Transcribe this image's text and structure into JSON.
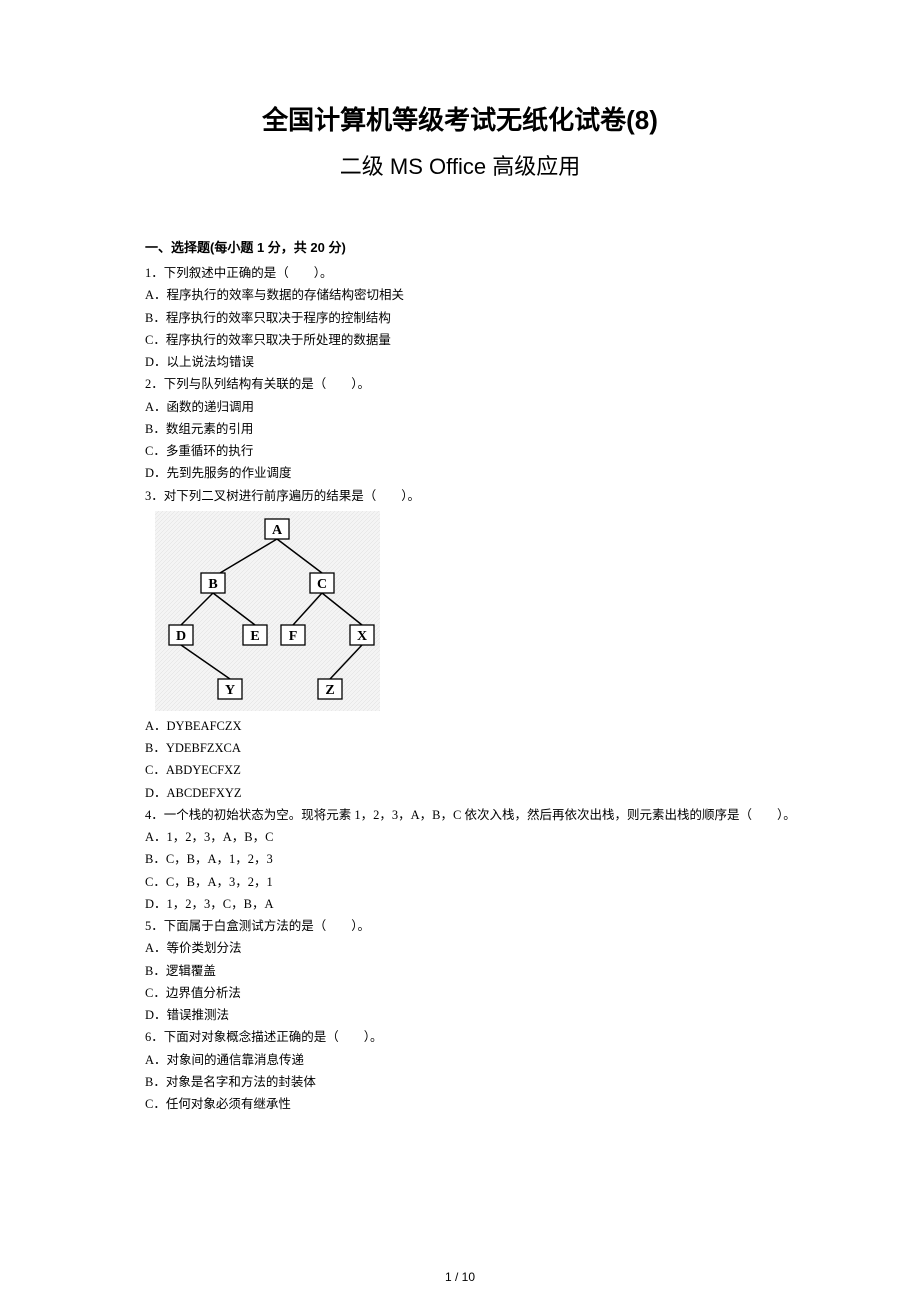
{
  "title_main": "全国计算机等级考试无纸化试卷(8)",
  "title_sub": "二级 MS Office 高级应用",
  "section": "一、选择题(每小题 1 分，共 20 分)",
  "q1": {
    "stem": "1．下列叙述中正确的是（　　）。",
    "A": "A．程序执行的效率与数据的存储结构密切相关",
    "B": "B．程序执行的效率只取决于程序的控制结构",
    "C": "C．程序执行的效率只取决于所处理的数据量",
    "D": "D．以上说法均错误"
  },
  "q2": {
    "stem": "2．下列与队列结构有关联的是（　　）。",
    "A": "A．函数的递归调用",
    "B": "B．数组元素的引用",
    "C": "C．多重循环的执行",
    "D": "D．先到先服务的作业调度"
  },
  "q3": {
    "stem": "3．对下列二叉树进行前序遍历的结果是（　　）。",
    "A": "A．DYBEAFCZX",
    "B": "B．YDEBFZXCA",
    "C": "C．ABDYECFXZ",
    "D": "D．ABCDEFXYZ"
  },
  "tree": {
    "A": "A",
    "B": "B",
    "C": "C",
    "D": "D",
    "E": "E",
    "F": "F",
    "X": "X",
    "Y": "Y",
    "Z": "Z"
  },
  "q4": {
    "stem": "4．一个栈的初始状态为空。现将元素 1，2，3，A，B，C 依次入栈，然后再依次出栈，则元素出栈的顺序是（　　）。",
    "A": "A．1，2，3，A，B，C",
    "B": "B．C，B，A，1，2，3",
    "C": "C．C，B，A，3，2，1",
    "D": "D．1，2，3，C，B，A"
  },
  "q5": {
    "stem": "5．下面属于白盒测试方法的是（　　）。",
    "A": "A．等价类划分法",
    "B": "B．逻辑覆盖",
    "C": "C．边界值分析法",
    "D": "D．错误推测法"
  },
  "q6": {
    "stem": "6．下面对对象概念描述正确的是（　　）。",
    "A": "A．对象间的通信靠消息传递",
    "B": "B．对象是名字和方法的封装体",
    "C": "C．任何对象必须有继承性"
  },
  "page_num": "1 / 10"
}
